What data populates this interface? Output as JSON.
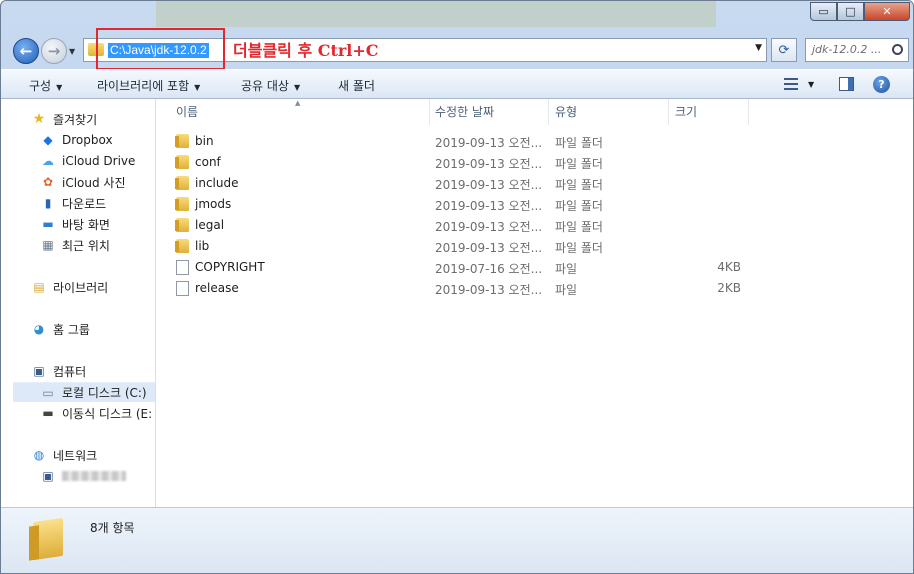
{
  "window": {
    "minimize": "▭",
    "maximize": "□",
    "close": "✕"
  },
  "address": {
    "path": "C:\\Java\\jdk-12.0.2",
    "annotation": "더블클릭 후 Ctrl+C",
    "search_placeholder": "jdk-12.0.2 ..."
  },
  "toolbar": {
    "organize": "구성",
    "include_library": "라이브러리에 포함",
    "share_with": "공유 대상",
    "new_folder": "새 폴더"
  },
  "nav": {
    "favorites": "즐겨찾기",
    "dropbox": "Dropbox",
    "icloud_drive": "iCloud Drive",
    "icloud_photos": "iCloud 사진",
    "downloads": "다운로드",
    "desktop": "바탕 화면",
    "recent": "최근 위치",
    "libraries": "라이브러리",
    "homegroup": "홈 그룹",
    "computer": "컴퓨터",
    "local_disk": "로컬 디스크 (C:)",
    "removable_disk": "이동식 디스크 (E:",
    "network": "네트워크"
  },
  "columns": {
    "name": "이름",
    "date": "수정한 날짜",
    "type": "유형",
    "size": "크기"
  },
  "files": [
    {
      "name": "bin",
      "date": "2019-09-13 오전...",
      "type": "파일 폴더",
      "size": "",
      "kind": "folder"
    },
    {
      "name": "conf",
      "date": "2019-09-13 오전...",
      "type": "파일 폴더",
      "size": "",
      "kind": "folder"
    },
    {
      "name": "include",
      "date": "2019-09-13 오전...",
      "type": "파일 폴더",
      "size": "",
      "kind": "folder"
    },
    {
      "name": "jmods",
      "date": "2019-09-13 오전...",
      "type": "파일 폴더",
      "size": "",
      "kind": "folder"
    },
    {
      "name": "legal",
      "date": "2019-09-13 오전...",
      "type": "파일 폴더",
      "size": "",
      "kind": "folder"
    },
    {
      "name": "lib",
      "date": "2019-09-13 오전...",
      "type": "파일 폴더",
      "size": "",
      "kind": "folder"
    },
    {
      "name": "COPYRIGHT",
      "date": "2019-07-16 오전...",
      "type": "파일",
      "size": "4KB",
      "kind": "file"
    },
    {
      "name": "release",
      "date": "2019-09-13 오전...",
      "type": "파일",
      "size": "2KB",
      "kind": "file"
    }
  ],
  "status": {
    "item_count": "8개 항목"
  },
  "colors": {
    "annotation_red": "#e0282e",
    "selection_blue": "#3399ff"
  }
}
